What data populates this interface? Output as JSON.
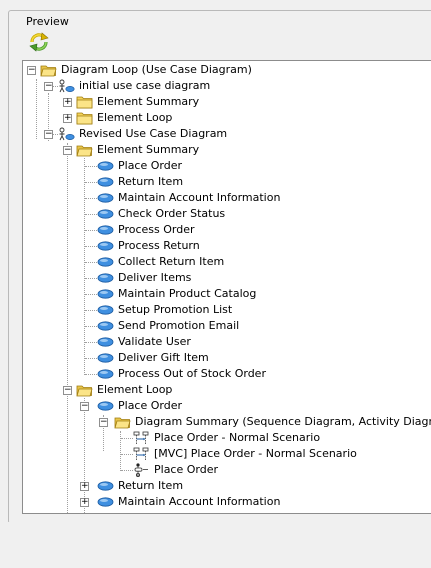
{
  "panel": {
    "title": "Preview"
  },
  "tree": {
    "root": "Diagram Loop (Use Case Diagram)",
    "diagram1": "initial use case diagram",
    "d1_element_summary": "Element Summary",
    "d1_element_loop": "Element Loop",
    "diagram2": "Revised Use Case Diagram",
    "d2_element_summary": "Element Summary",
    "use_cases": [
      "Place Order",
      "Return Item",
      "Maintain Account Information",
      "Check Order Status",
      "Process Order",
      "Process Return",
      "Collect Return Item",
      "Deliver Items",
      "Maintain Product Catalog",
      "Setup Promotion List",
      "Send Promotion Email",
      "Validate User",
      "Deliver Gift Item",
      "Process Out of Stock Order"
    ],
    "d2_element_loop": "Element Loop",
    "loop_place_order": "Place Order",
    "diagram_summary": "Diagram Summary (Sequence Diagram, Activity Diagram)",
    "sub_diagrams": [
      "Place Order - Normal Scenario",
      "[MVC] Place Order - Normal Scenario",
      "Place Order"
    ],
    "loop_return_item": "Return Item",
    "loop_maintain_account": "Maintain Account Information"
  }
}
